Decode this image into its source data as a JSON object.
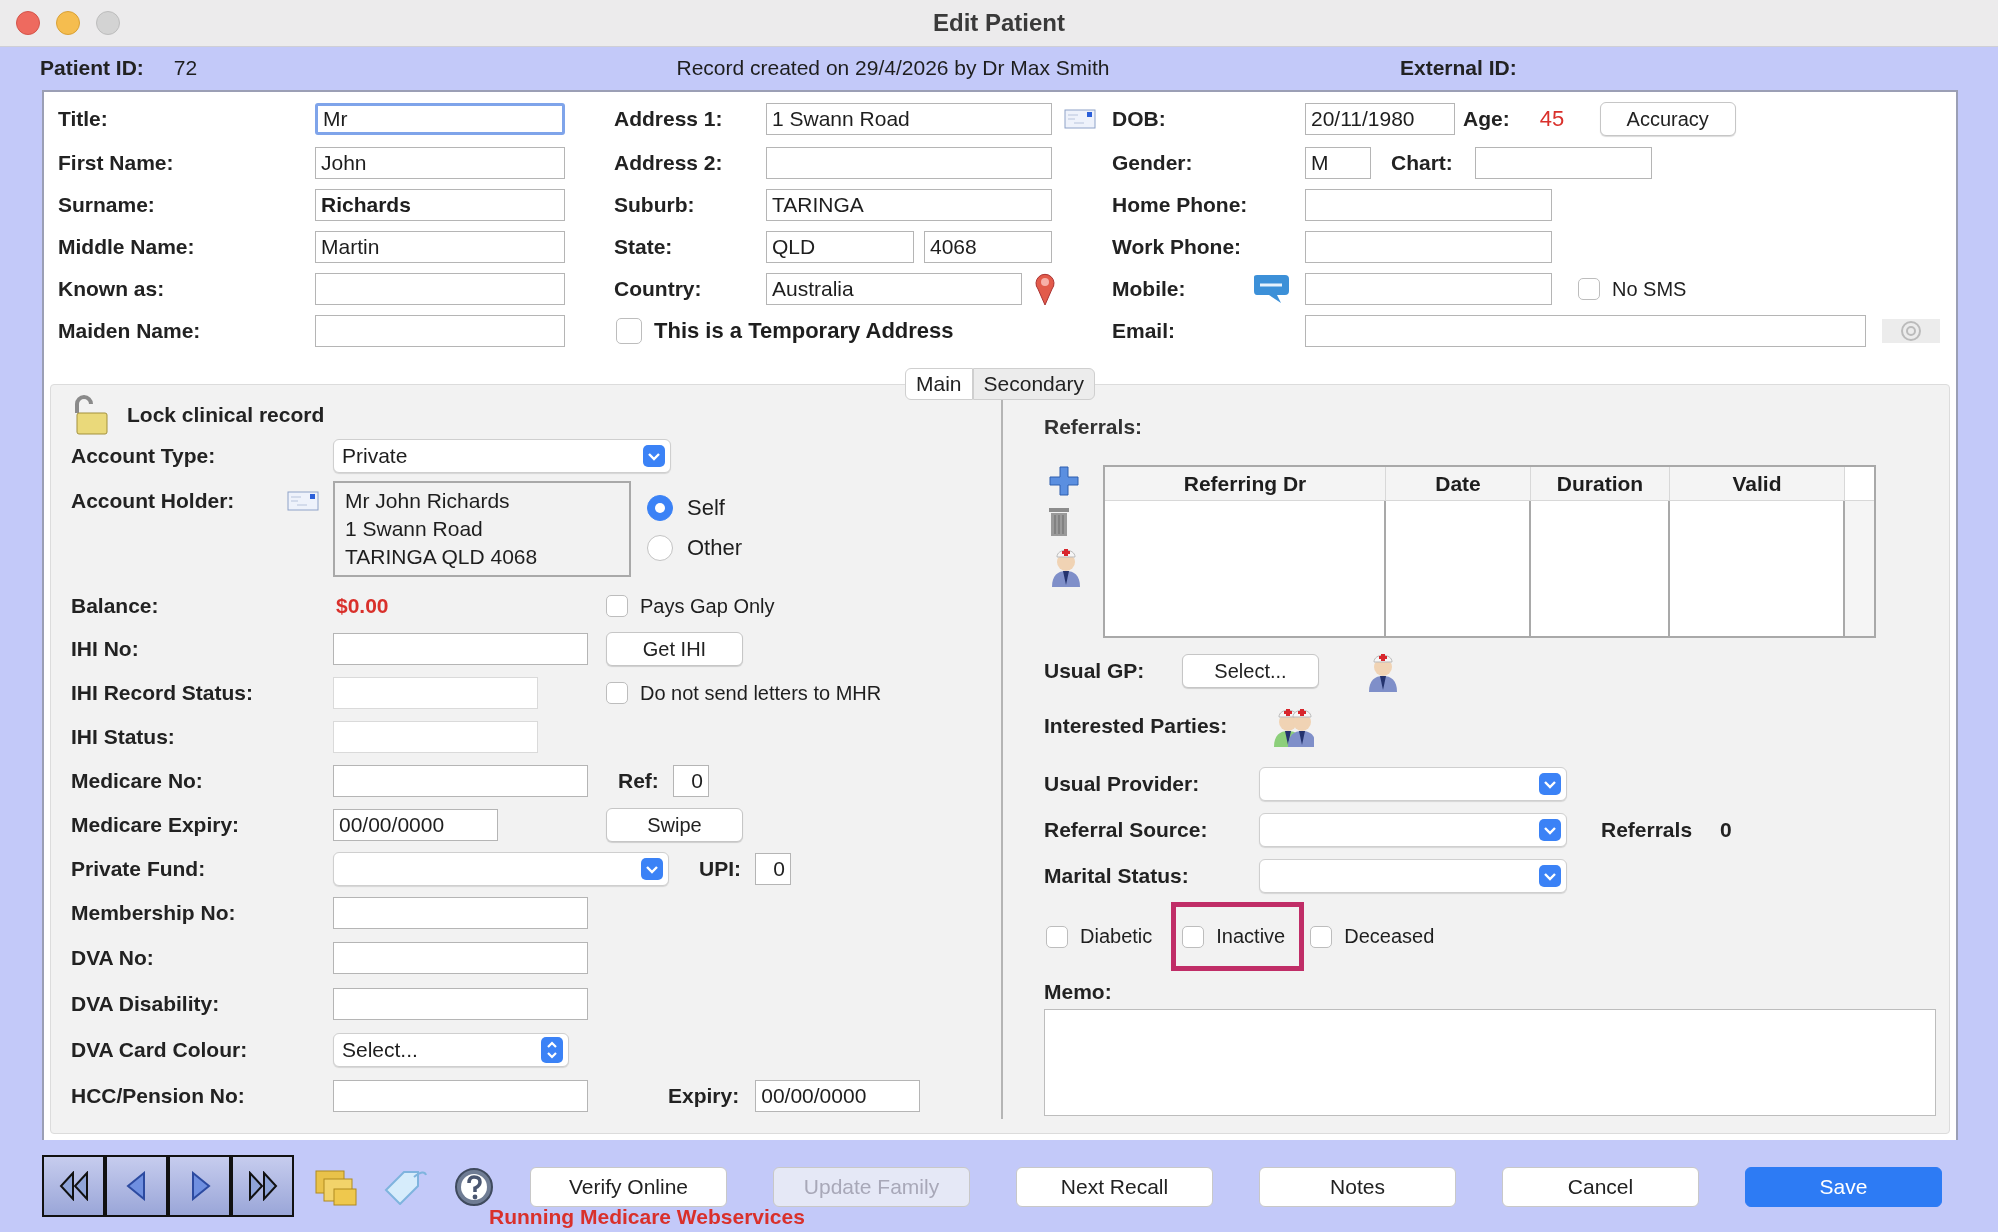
{
  "window": {
    "title": "Edit Patient"
  },
  "header": {
    "patient_id_label": "Patient ID:",
    "patient_id": "72",
    "record_created": "Record created on 29/4/2026 by Dr Max Smith",
    "external_id_label": "External ID:"
  },
  "name_fields": [
    {
      "label": "Title:",
      "value": "Mr",
      "focused": true,
      "bold": false
    },
    {
      "label": "First Name:",
      "value": "John",
      "focused": false,
      "bold": false
    },
    {
      "label": "Surname:",
      "value": "Richards",
      "focused": false,
      "bold": true
    },
    {
      "label": "Middle Name:",
      "value": "Martin",
      "focused": false,
      "bold": false
    },
    {
      "label": "Known as:",
      "focused": false
    },
    {
      "label": "Maiden Name:",
      "focused": false
    }
  ],
  "address_fields": [
    {
      "kind": "envelope",
      "label": "Address 1:",
      "value": "1 Swann Road"
    },
    {
      "kind": "plain",
      "label": "Address 2:"
    },
    {
      "kind": "plain",
      "label": "Suburb:",
      "value": "TARINGA"
    },
    {
      "kind": "pair",
      "label": "State:",
      "values": [
        "QLD",
        "4068"
      ]
    },
    {
      "kind": "pin",
      "label": "Country:",
      "value": "Australia"
    }
  ],
  "temporary_address": {
    "label": "This is a Temporary Address",
    "checked": false
  },
  "dob": {
    "label": "DOB:",
    "value": "20/11/1980",
    "age_label": "Age:",
    "age": "45",
    "accuracy_button": "Accuracy"
  },
  "gender": {
    "label": "Gender:",
    "value": "M",
    "chart_label": "Chart:"
  },
  "phones": [
    {
      "label": "Home Phone:"
    },
    {
      "label": "Work Phone:"
    }
  ],
  "mobile": {
    "label": "Mobile:",
    "no_sms": {
      "label": "No SMS",
      "checked": false
    }
  },
  "email": {
    "label": "Email:"
  },
  "tabs": [
    {
      "label": "Main",
      "selected": true
    },
    {
      "label": "Secondary",
      "selected": false
    }
  ],
  "main": {
    "lock": {
      "label": "Lock clinical record",
      "locked": false
    },
    "account_type": {
      "label": "Account Type:",
      "value": "Private"
    },
    "account_holder": {
      "label": "Account Holder:",
      "lines": [
        "Mr John Richards",
        "1 Swann Road",
        "TARINGA QLD 4068"
      ],
      "options": [
        {
          "label": "Self",
          "selected": true
        },
        {
          "label": "Other",
          "selected": false
        }
      ]
    },
    "balance": {
      "label": "Balance:",
      "value": "$0.00"
    },
    "pays_gap_only": {
      "label": "Pays Gap Only",
      "checked": false
    },
    "ihi_no": {
      "label": "IHI No:",
      "button": "Get IHI"
    },
    "ihi_record_status": {
      "label": "IHI Record Status:"
    },
    "mhr_letters": {
      "label": "Do not send letters to MHR",
      "checked": false
    },
    "ihi_status": {
      "label": "IHI Status:"
    },
    "medicare_no": {
      "label": "Medicare No:",
      "ref_label": "Ref:",
      "ref": "0"
    },
    "medicare_expiry": {
      "label": "Medicare Expiry:",
      "value": "00/00/0000",
      "button": "Swipe"
    },
    "private_fund": {
      "label": "Private Fund:",
      "upi_label": "UPI:",
      "upi": "0"
    },
    "membership_no": {
      "label": "Membership No:"
    },
    "dva_no": {
      "label": "DVA No:"
    },
    "dva_disability": {
      "label": "DVA Disability:"
    },
    "dva_card_colour": {
      "label": "DVA Card Colour:",
      "value": "Select..."
    },
    "hcc_pension_no": {
      "label": "HCC/Pension No:",
      "expiry_label": "Expiry:",
      "expiry": "00/00/0000"
    }
  },
  "clinical": {
    "referrals": {
      "label": "Referrals:",
      "columns": [
        "Referring Dr",
        "Date",
        "Duration",
        "Valid"
      ]
    },
    "usual_gp": {
      "label": "Usual GP:",
      "button": "Select..."
    },
    "interested_parties": {
      "label": "Interested Parties:"
    },
    "dropdowns": [
      {
        "label": "Usual Provider:"
      },
      {
        "label": "Referral Source:"
      },
      {
        "label": "Marital Status:"
      }
    ],
    "referral_count": {
      "label": "Referrals",
      "value": "0"
    },
    "flags": [
      {
        "label": "Diabetic",
        "checked": false,
        "highlighted": false
      },
      {
        "label": "Inactive",
        "checked": false,
        "highlighted": true
      },
      {
        "label": "Deceased",
        "checked": false,
        "highlighted": false
      }
    ],
    "memo": {
      "label": "Memo:"
    }
  },
  "footer": {
    "buttons": [
      {
        "label": "Verify Online",
        "kind": "default",
        "disabled": false
      },
      {
        "label": "Update Family",
        "kind": "default",
        "disabled": true
      },
      {
        "label": "Next Recall",
        "kind": "default",
        "disabled": false
      },
      {
        "label": "Notes",
        "kind": "default",
        "disabled": false
      },
      {
        "label": "Cancel",
        "kind": "default",
        "disabled": false
      },
      {
        "label": "Save",
        "kind": "primary",
        "disabled": false
      }
    ],
    "status": "Running Medicare Webservices"
  }
}
